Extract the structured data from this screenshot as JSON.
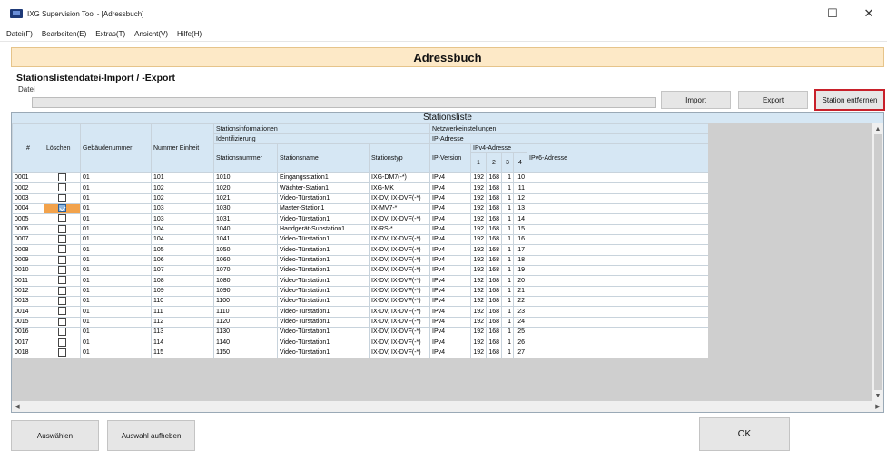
{
  "window": {
    "title": "IXG Supervision Tool - [Adressbuch]",
    "minimize": "–",
    "maximize": "☐",
    "close": "✕"
  },
  "menu": [
    "Datei(F)",
    "Bearbeiten(E)",
    "Extras(T)",
    "Ansicht(V)",
    "Hilfe(H)"
  ],
  "page": {
    "header": "Adressbuch",
    "section_title": "Stationslistendatei-Import / -Export",
    "file_label": "Datei",
    "file_value": ""
  },
  "buttons": {
    "import": "Import",
    "export": "Export",
    "remove_station": "Station entfernen",
    "select": "Auswählen",
    "deselect": "Auswahl aufheben",
    "ok": "OK"
  },
  "list": {
    "caption": "Stationsliste",
    "headers": {
      "num": "#",
      "delete": "Löschen",
      "building": "Gebäudenummer",
      "unit": "Nummer Einheit",
      "station_info": "Stationsinformationen",
      "identification": "Identifizierung",
      "station_number": "Stationsnummer",
      "station_name": "Stationsname",
      "station_type": "Stationstyp",
      "network": "Netzwerkeinstellungen",
      "ip_address": "IP-Adresse",
      "ip_version": "IP-Version",
      "ipv4": "IPv4-Adresse",
      "ipv4_1": "1",
      "ipv4_2": "2",
      "ipv4_3": "3",
      "ipv4_4": "4",
      "ipv6": "IPv6-Adresse"
    },
    "rows": [
      {
        "num": "0001",
        "checked": false,
        "building": "01",
        "unit": "101",
        "station_number": "1010",
        "station_name": "Eingangsstation1",
        "station_type": "IXG-DM7(-*)",
        "ip_version": "IPv4",
        "o1": "192",
        "o2": "168",
        "o3": "1",
        "o4": "10",
        "ipv6": ""
      },
      {
        "num": "0002",
        "checked": false,
        "building": "01",
        "unit": "102",
        "station_number": "1020",
        "station_name": "Wächter-Station1",
        "station_type": "IXG-MK",
        "ip_version": "IPv4",
        "o1": "192",
        "o2": "168",
        "o3": "1",
        "o4": "11",
        "ipv6": ""
      },
      {
        "num": "0003",
        "checked": false,
        "building": "01",
        "unit": "102",
        "station_number": "1021",
        "station_name": "Video-Türstation1",
        "station_type": "IX-DV, IX-DVF(-*)",
        "ip_version": "IPv4",
        "o1": "192",
        "o2": "168",
        "o3": "1",
        "o4": "12",
        "ipv6": ""
      },
      {
        "num": "0004",
        "checked": true,
        "building": "01",
        "unit": "103",
        "station_number": "1030",
        "station_name": "Master-Station1",
        "station_type": "IX-MV7-*",
        "ip_version": "IPv4",
        "o1": "192",
        "o2": "168",
        "o3": "1",
        "o4": "13",
        "ipv6": ""
      },
      {
        "num": "0005",
        "checked": false,
        "building": "01",
        "unit": "103",
        "station_number": "1031",
        "station_name": "Video-Türstation1",
        "station_type": "IX-DV, IX-DVF(-*)",
        "ip_version": "IPv4",
        "o1": "192",
        "o2": "168",
        "o3": "1",
        "o4": "14",
        "ipv6": ""
      },
      {
        "num": "0006",
        "checked": false,
        "building": "01",
        "unit": "104",
        "station_number": "1040",
        "station_name": "Handgerät-Substation1",
        "station_type": "IX-RS-*",
        "ip_version": "IPv4",
        "o1": "192",
        "o2": "168",
        "o3": "1",
        "o4": "15",
        "ipv6": ""
      },
      {
        "num": "0007",
        "checked": false,
        "building": "01",
        "unit": "104",
        "station_number": "1041",
        "station_name": "Video-Türstation1",
        "station_type": "IX-DV, IX-DVF(-*)",
        "ip_version": "IPv4",
        "o1": "192",
        "o2": "168",
        "o3": "1",
        "o4": "16",
        "ipv6": ""
      },
      {
        "num": "0008",
        "checked": false,
        "building": "01",
        "unit": "105",
        "station_number": "1050",
        "station_name": "Video-Türstation1",
        "station_type": "IX-DV, IX-DVF(-*)",
        "ip_version": "IPv4",
        "o1": "192",
        "o2": "168",
        "o3": "1",
        "o4": "17",
        "ipv6": ""
      },
      {
        "num": "0009",
        "checked": false,
        "building": "01",
        "unit": "106",
        "station_number": "1060",
        "station_name": "Video-Türstation1",
        "station_type": "IX-DV, IX-DVF(-*)",
        "ip_version": "IPv4",
        "o1": "192",
        "o2": "168",
        "o3": "1",
        "o4": "18",
        "ipv6": ""
      },
      {
        "num": "0010",
        "checked": false,
        "building": "01",
        "unit": "107",
        "station_number": "1070",
        "station_name": "Video-Türstation1",
        "station_type": "IX-DV, IX-DVF(-*)",
        "ip_version": "IPv4",
        "o1": "192",
        "o2": "168",
        "o3": "1",
        "o4": "19",
        "ipv6": ""
      },
      {
        "num": "0011",
        "checked": false,
        "building": "01",
        "unit": "108",
        "station_number": "1080",
        "station_name": "Video-Türstation1",
        "station_type": "IX-DV, IX-DVF(-*)",
        "ip_version": "IPv4",
        "o1": "192",
        "o2": "168",
        "o3": "1",
        "o4": "20",
        "ipv6": ""
      },
      {
        "num": "0012",
        "checked": false,
        "building": "01",
        "unit": "109",
        "station_number": "1090",
        "station_name": "Video-Türstation1",
        "station_type": "IX-DV, IX-DVF(-*)",
        "ip_version": "IPv4",
        "o1": "192",
        "o2": "168",
        "o3": "1",
        "o4": "21",
        "ipv6": ""
      },
      {
        "num": "0013",
        "checked": false,
        "building": "01",
        "unit": "110",
        "station_number": "1100",
        "station_name": "Video-Türstation1",
        "station_type": "IX-DV, IX-DVF(-*)",
        "ip_version": "IPv4",
        "o1": "192",
        "o2": "168",
        "o3": "1",
        "o4": "22",
        "ipv6": ""
      },
      {
        "num": "0014",
        "checked": false,
        "building": "01",
        "unit": "111",
        "station_number": "1110",
        "station_name": "Video-Türstation1",
        "station_type": "IX-DV, IX-DVF(-*)",
        "ip_version": "IPv4",
        "o1": "192",
        "o2": "168",
        "o3": "1",
        "o4": "23",
        "ipv6": ""
      },
      {
        "num": "0015",
        "checked": false,
        "building": "01",
        "unit": "112",
        "station_number": "1120",
        "station_name": "Video-Türstation1",
        "station_type": "IX-DV, IX-DVF(-*)",
        "ip_version": "IPv4",
        "o1": "192",
        "o2": "168",
        "o3": "1",
        "o4": "24",
        "ipv6": ""
      },
      {
        "num": "0016",
        "checked": false,
        "building": "01",
        "unit": "113",
        "station_number": "1130",
        "station_name": "Video-Türstation1",
        "station_type": "IX-DV, IX-DVF(-*)",
        "ip_version": "IPv4",
        "o1": "192",
        "o2": "168",
        "o3": "1",
        "o4": "25",
        "ipv6": ""
      },
      {
        "num": "0017",
        "checked": false,
        "building": "01",
        "unit": "114",
        "station_number": "1140",
        "station_name": "Video-Türstation1",
        "station_type": "IX-DV, IX-DVF(-*)",
        "ip_version": "IPv4",
        "o1": "192",
        "o2": "168",
        "o3": "1",
        "o4": "26",
        "ipv6": ""
      },
      {
        "num": "0018",
        "checked": false,
        "building": "01",
        "unit": "115",
        "station_number": "1150",
        "station_name": "Video-Türstation1",
        "station_type": "IX-DV, IX-DVF(-*)",
        "ip_version": "IPv4",
        "o1": "192",
        "o2": "168",
        "o3": "1",
        "o4": "27",
        "ipv6": ""
      }
    ]
  },
  "colors": {
    "header_bg": "#fde9c7",
    "table_header_bg": "#d6e7f4",
    "highlight_border": "#c8202a",
    "selected_cell": "#f2a24b"
  },
  "icons": {
    "app": "app-icon",
    "scroll_up": "▲",
    "scroll_down": "▼",
    "scroll_left": "◀",
    "scroll_right": "▶"
  }
}
